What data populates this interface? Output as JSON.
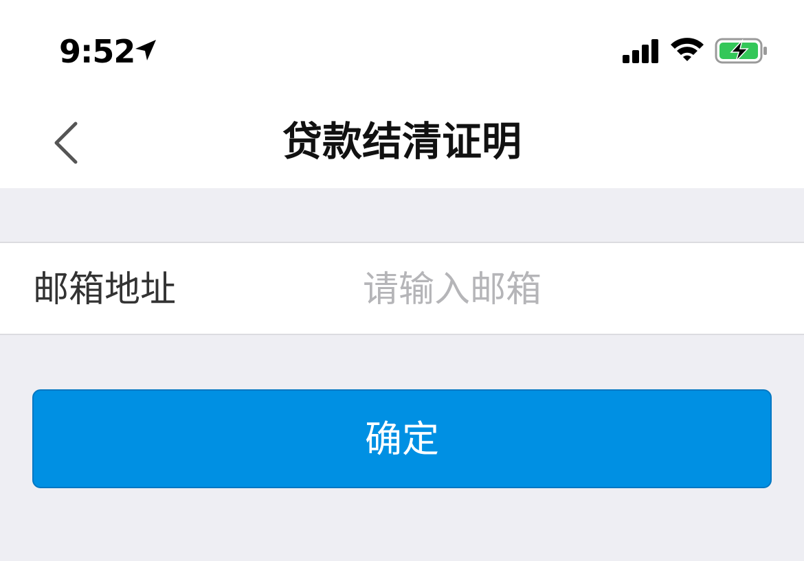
{
  "status_bar": {
    "time": "9:52",
    "icons": [
      "location-arrow-icon",
      "cellular-signal-icon",
      "wifi-icon",
      "battery-charging-icon"
    ],
    "battery_color": "#34C759"
  },
  "nav": {
    "title": "贷款结清证明",
    "back_icon": "chevron-left-icon"
  },
  "form": {
    "email_label": "邮箱地址",
    "email_value": "",
    "email_placeholder": "请输入邮箱"
  },
  "actions": {
    "confirm_label": "确定",
    "accent_color": "#0090E3"
  }
}
